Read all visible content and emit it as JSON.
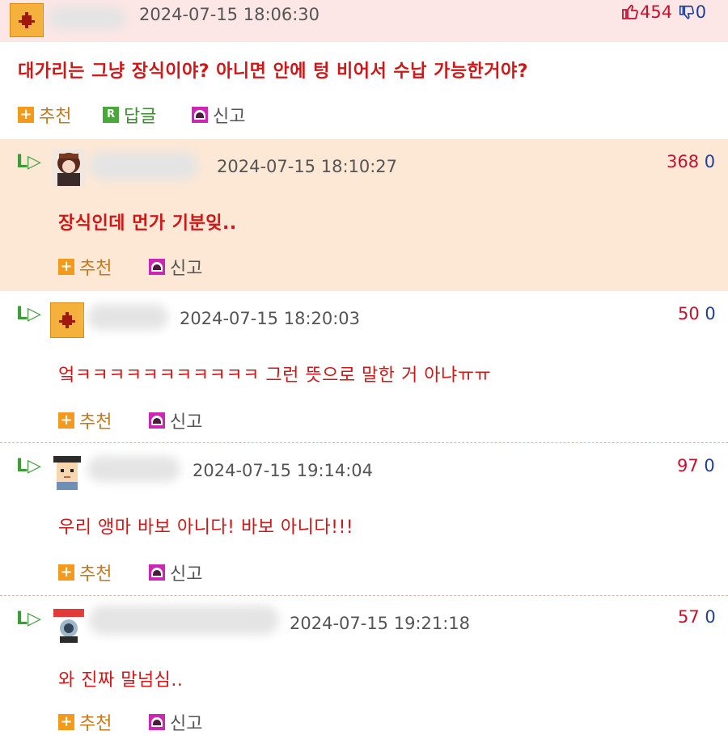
{
  "colors": {
    "header_bg": "#fde6e6",
    "highlight_bg": "#fde8d6",
    "message_red": "#d01717",
    "upvote_red": "#c8102e",
    "downvote_blue": "#1f3f99"
  },
  "main_post": {
    "date": "2024-07-15 18:06:30",
    "upvotes": "454",
    "downvotes": "0",
    "message": "대가리는 그냥 장식이야? 아니면 안에 텅 비어서 수납 가능한거야?",
    "actions": {
      "recommend": "추천",
      "reply": "답글",
      "report": "신고"
    },
    "icons": {
      "up": "thumbs-up-icon",
      "down": "thumbs-down-icon"
    }
  },
  "comments": [
    {
      "date": "2024-07-15 18:10:27",
      "upvotes": "368",
      "downvotes": "0",
      "message": "장식인데 먼가 기분잊..",
      "recommend": "추천",
      "report": "신고"
    },
    {
      "date": "2024-07-15 18:20:03",
      "upvotes": "50",
      "downvotes": "0",
      "message": "엌ㅋㅋㅋㅋㅋㅋㅋㅋㅋㅋㅋ 그런 뜻으로 말한 거 아냐ㅠㅠ",
      "recommend": "추천",
      "report": "신고"
    },
    {
      "date": "2024-07-15 19:14:04",
      "upvotes": "97",
      "downvotes": "0",
      "message": "우리 앵마 바보 아니다! 바보 아니다!!!",
      "recommend": "추천",
      "report": "신고"
    },
    {
      "date": "2024-07-15 19:21:18",
      "upvotes": "57",
      "downvotes": "0",
      "message": "와 진짜 말넘심..",
      "recommend": "추천",
      "report": "신고"
    }
  ]
}
